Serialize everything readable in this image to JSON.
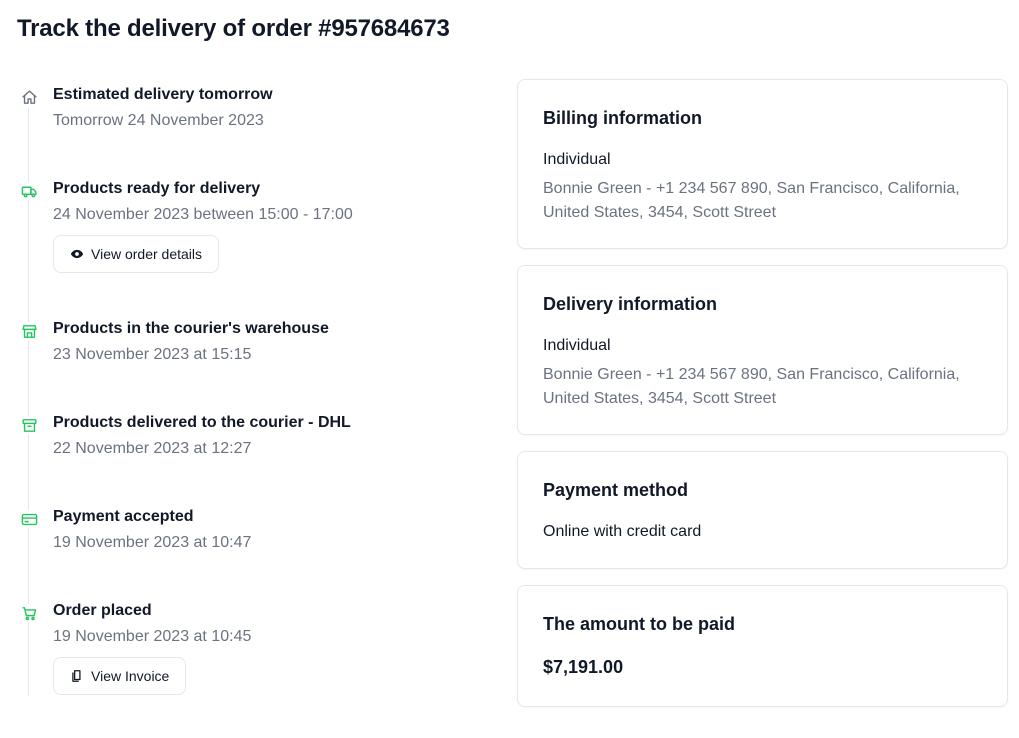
{
  "page": {
    "title": "Track the delivery of order #957684673"
  },
  "timeline": {
    "accent_color": "#22c55e",
    "muted_icon_color": "#6b7280",
    "items": [
      {
        "title": "Estimated delivery tomorrow",
        "subtitle": "Tomorrow 24 November 2023",
        "icon": "home-icon"
      },
      {
        "title": "Products ready for delivery",
        "subtitle": "24 November 2023 between 15:00 - 17:00",
        "icon": "truck-icon",
        "button": "View order details"
      },
      {
        "title": "Products in the courier's warehouse",
        "subtitle": "23 November 2023 at 15:15",
        "icon": "store-icon"
      },
      {
        "title": "Products delivered to the courier - DHL",
        "subtitle": "22 November 2023 at 12:27",
        "icon": "archive-box-icon"
      },
      {
        "title": "Payment accepted",
        "subtitle": "19 November 2023 at 10:47",
        "icon": "credit-card-icon"
      },
      {
        "title": "Order placed",
        "subtitle": "19 November 2023 at 10:45",
        "icon": "cart-icon",
        "button": "View Invoice"
      }
    ]
  },
  "billing": {
    "title": "Billing information",
    "type": "Individual",
    "details": "Bonnie Green - +1 234 567 890, San Francisco, California, United States, 3454, Scott Street"
  },
  "delivery": {
    "title": "Delivery information",
    "type": "Individual",
    "details": "Bonnie Green - +1 234 567 890, San Francisco, California, United States, 3454, Scott Street"
  },
  "payment": {
    "title": "Payment method",
    "method": "Online with credit card"
  },
  "amount": {
    "title": "The amount to be paid",
    "value": "$7,191.00"
  }
}
